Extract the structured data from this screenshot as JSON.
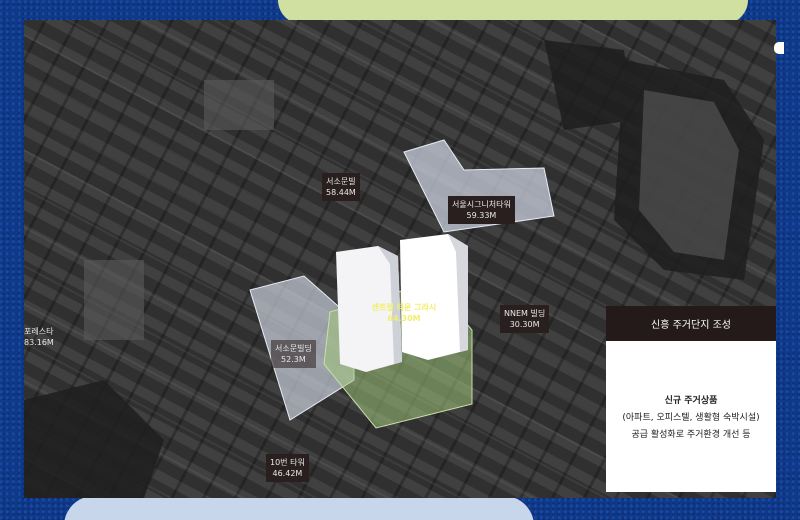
{
  "map": {
    "labels": {
      "north": {
        "name": "서소문빌",
        "height": "58.44M"
      },
      "northeast": {
        "name": "서울시그니처타워",
        "height": "59.33M"
      },
      "east": {
        "name": "NNEM 빌딩",
        "height": "30.30M"
      },
      "west": {
        "name": "서소문빌딩",
        "height": "52.3M"
      },
      "south": {
        "name": "10번 타워",
        "height": "46.42M"
      },
      "left_edge": {
        "name": "포레스타",
        "height": "83.16M"
      },
      "center": {
        "name": "센트럴 타운 그라시",
        "height": "64.30M"
      }
    }
  },
  "panel": {
    "header": "신흥 주거단지 조성",
    "title": "신규 주거상품",
    "line2": "(아파트, 오피스텔, 생활형 숙박시설)",
    "line3": "공급 활성화로 주거환경 개선 등"
  },
  "colors": {
    "background": "#0f3a8c",
    "label_bg": "#2a1f1f",
    "highlight": "#f2ef6a",
    "site_green": "#9ec47a"
  }
}
